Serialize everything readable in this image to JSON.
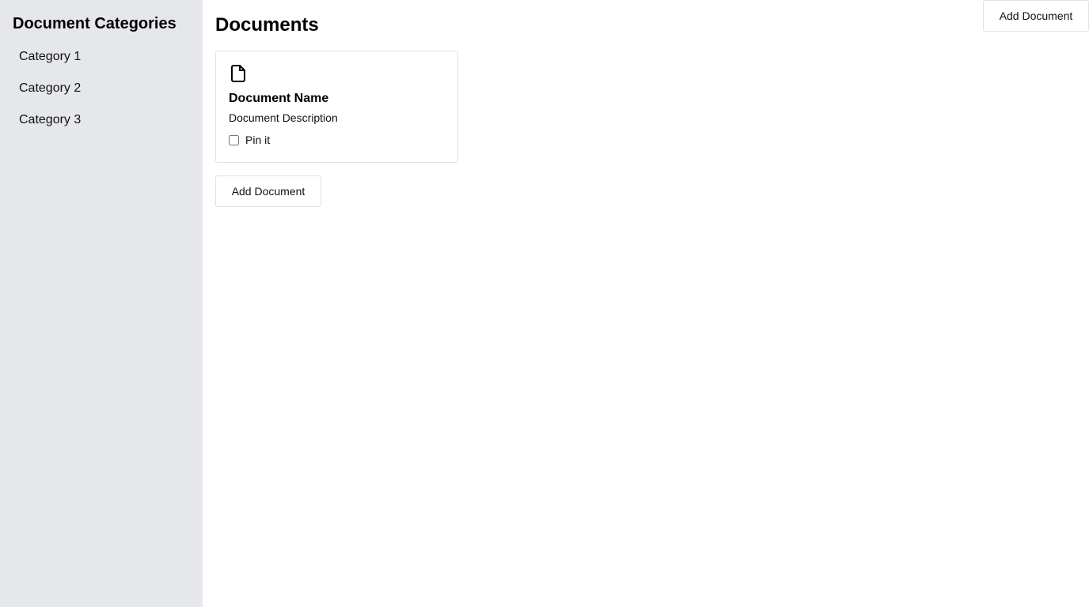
{
  "sidebar": {
    "title": "Document Categories",
    "categories": [
      {
        "label": "Category 1"
      },
      {
        "label": "Category 2"
      },
      {
        "label": "Category 3"
      }
    ]
  },
  "main": {
    "title": "Documents",
    "documents": [
      {
        "icon": "document-icon",
        "name": "Document Name",
        "description": "Document Description",
        "pin_label": "Pin it",
        "pinned": false
      }
    ],
    "add_button_label": "Add Document"
  },
  "header": {
    "add_button_label": "Add Document"
  },
  "colors": {
    "sidebar_bg": "#e5e7eb",
    "border": "#e2e2e2"
  }
}
